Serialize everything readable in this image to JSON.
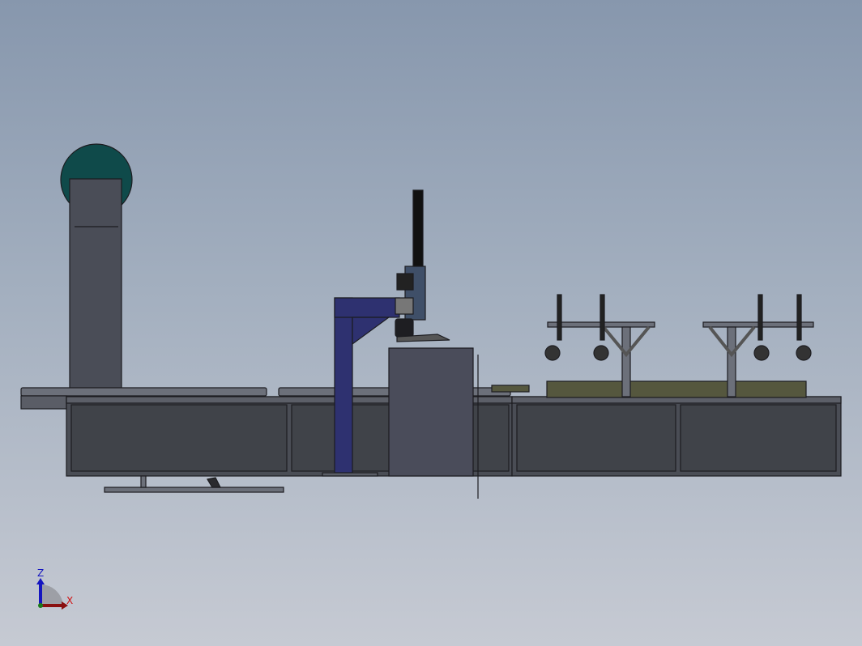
{
  "triad": {
    "z_label": "Z",
    "x_label": "X"
  },
  "colors": {
    "frame": "#4a4d55",
    "frame_edge": "#1c1c20",
    "gantry": "#2e3170",
    "drum": "#0f4a4a",
    "cabinet": "#4a4c5a",
    "fixture_plate": "#55573e",
    "z_axis": "#1515c0",
    "x_axis": "#8a1010"
  }
}
